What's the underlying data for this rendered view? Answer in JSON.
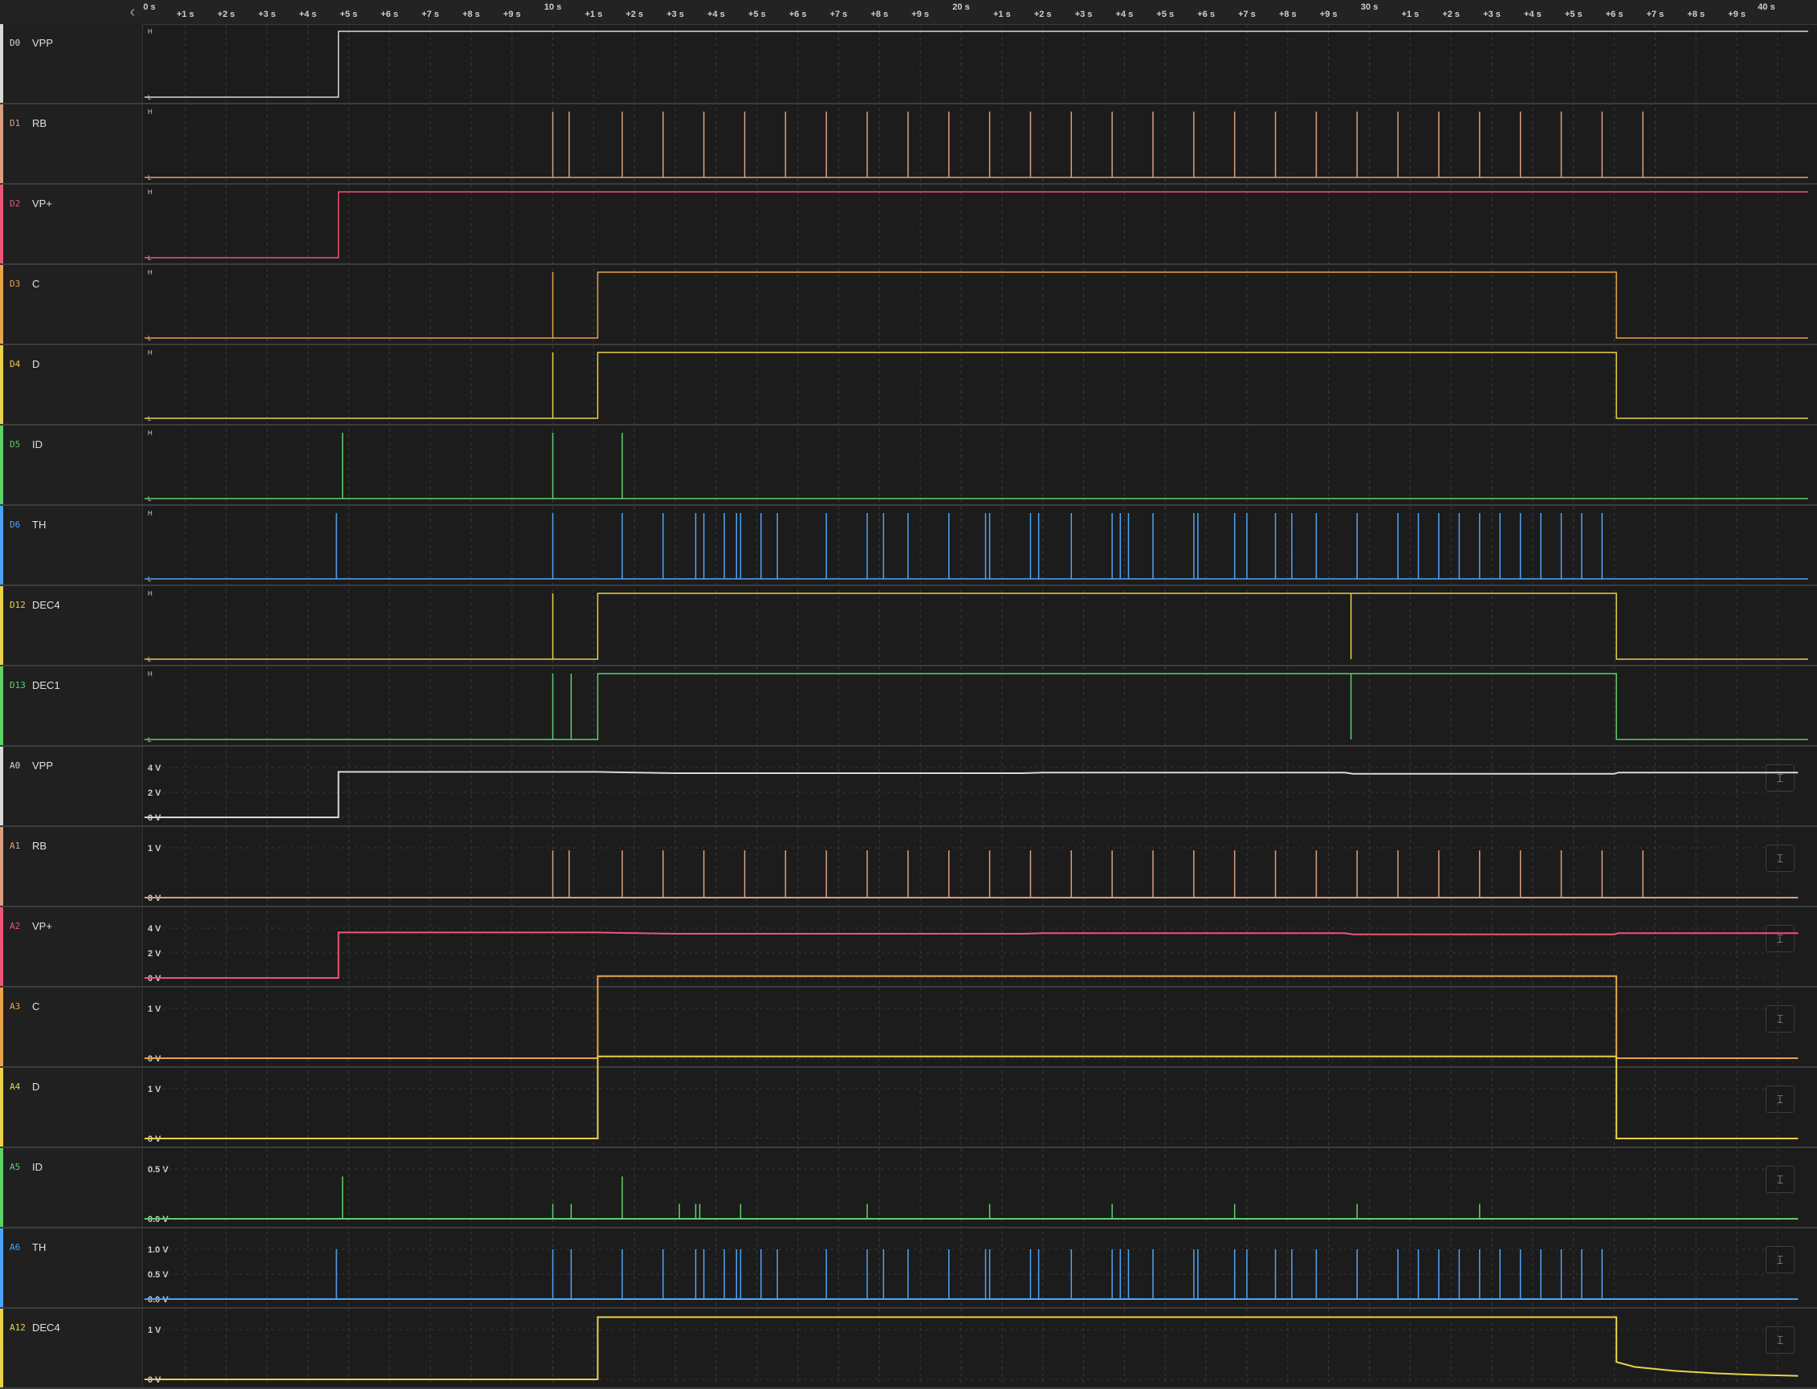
{
  "ruler": {
    "major": [
      "0 s",
      "10 s",
      "20 s",
      "30 s",
      "40 s"
    ],
    "minor": [
      "+1 s",
      "+2 s",
      "+3 s",
      "+4 s",
      "+5 s",
      "+6 s",
      "+7 s",
      "+8 s",
      "+9 s"
    ]
  },
  "collapse_icon": "chevron-left-icon",
  "axis_icon": "fit-vertical-icon",
  "channels": [
    {
      "id": "D0",
      "name": "VPP",
      "color": "#d9d9d9",
      "type": "digital",
      "signal": [
        [
          0,
          0
        ],
        [
          4.75,
          1
        ]
      ]
    },
    {
      "id": "D1",
      "name": "RB",
      "color": "#d9a07f",
      "type": "digital",
      "pulses": [
        10,
        10.4,
        11.7,
        12.7,
        13.7,
        14.7,
        15.7,
        16.7,
        17.7,
        18.7,
        19.7,
        20.7,
        21.7,
        22.7,
        23.7,
        24.7,
        25.7,
        26.7,
        27.7,
        28.7,
        29.7,
        30.7,
        31.7,
        32.7,
        33.7,
        34.7,
        35.7,
        36.7
      ]
    },
    {
      "id": "D2",
      "name": "VP+",
      "color": "#ef5577",
      "type": "digital",
      "signal": [
        [
          0,
          0
        ],
        [
          4.75,
          1
        ]
      ]
    },
    {
      "id": "D3",
      "name": "C",
      "color": "#e8a44a",
      "type": "digital",
      "signal": [
        [
          0,
          0
        ],
        [
          11.1,
          1
        ],
        [
          36.05,
          0
        ]
      ],
      "pulses": [
        10
      ]
    },
    {
      "id": "D4",
      "name": "D",
      "color": "#e9d24a",
      "type": "digital",
      "signal": [
        [
          0,
          0
        ],
        [
          11.1,
          1
        ],
        [
          36.05,
          0
        ]
      ],
      "pulses": [
        10
      ]
    },
    {
      "id": "D5",
      "name": "ID",
      "color": "#5ed06a",
      "type": "digital",
      "pulses": [
        4.85,
        10,
        11.7
      ]
    },
    {
      "id": "D6",
      "name": "TH",
      "color": "#4fa3f7",
      "type": "digital",
      "pulses": [
        4.7,
        10,
        11.7,
        12.7,
        13.5,
        13.7,
        14.2,
        14.5,
        14.6,
        15.1,
        15.5,
        16.7,
        17.7,
        18.1,
        18.7,
        19.7,
        20.6,
        20.7,
        21.7,
        21.9,
        22.7,
        23.7,
        23.9,
        24.1,
        24.7,
        25.7,
        25.8,
        26.7,
        27.0,
        27.7,
        28.1,
        28.7,
        29.7,
        30.7,
        31.2,
        31.7,
        32.2,
        32.7,
        33.2,
        33.7,
        34.2,
        34.7,
        35.2,
        35.7
      ]
    },
    {
      "id": "D12",
      "name": "DEC4",
      "color": "#e9d24a",
      "type": "digital",
      "signal": [
        [
          0,
          0
        ],
        [
          11.1,
          1
        ],
        [
          36.05,
          0
        ]
      ],
      "pulses": [
        10
      ],
      "dips": [
        29.55
      ]
    },
    {
      "id": "D13",
      "name": "DEC1",
      "color": "#5ed06a",
      "type": "digital",
      "signal": [
        [
          0,
          0
        ],
        [
          11.1,
          1
        ],
        [
          36.05,
          0
        ]
      ],
      "pulses": [
        10,
        10.45
      ],
      "dips": [
        29.55
      ]
    },
    {
      "id": "A0",
      "name": "VPP",
      "color": "#d9d9d9",
      "type": "analog",
      "scale": [
        "4 V",
        "2 V",
        "0 V"
      ],
      "min": 0,
      "max": 4,
      "trace": [
        [
          0,
          0
        ],
        [
          4.75,
          0
        ],
        [
          4.75,
          3.65
        ],
        [
          11.1,
          3.65
        ],
        [
          13,
          3.55
        ],
        [
          21.5,
          3.55
        ],
        [
          22,
          3.6
        ],
        [
          29.4,
          3.6
        ],
        [
          29.6,
          3.5
        ],
        [
          36.0,
          3.5
        ],
        [
          36.1,
          3.6
        ],
        [
          40.5,
          3.6
        ]
      ]
    },
    {
      "id": "A1",
      "name": "RB",
      "color": "#d9a07f",
      "type": "analog",
      "scale": [
        "1 V",
        "0 V"
      ],
      "min": 0,
      "max": 1,
      "trace": [
        [
          0,
          0
        ],
        [
          40.5,
          0
        ]
      ],
      "pulses": [
        10,
        10.4,
        11.7,
        12.7,
        13.7,
        14.7,
        15.7,
        16.7,
        17.7,
        18.7,
        19.7,
        20.7,
        21.7,
        22.7,
        23.7,
        24.7,
        25.7,
        26.7,
        27.7,
        28.7,
        29.7,
        30.7,
        31.7,
        32.7,
        33.7,
        34.7,
        35.7,
        36.7
      ],
      "pulse_height": 0.95
    },
    {
      "id": "A2",
      "name": "VP+",
      "color": "#ef5577",
      "type": "analog",
      "scale": [
        "4 V",
        "2 V",
        "0 V"
      ],
      "min": 0,
      "max": 4,
      "trace": [
        [
          0,
          0
        ],
        [
          4.75,
          0
        ],
        [
          4.75,
          3.65
        ],
        [
          11.1,
          3.65
        ],
        [
          13,
          3.55
        ],
        [
          21.5,
          3.55
        ],
        [
          22,
          3.6
        ],
        [
          29.4,
          3.6
        ],
        [
          29.6,
          3.5
        ],
        [
          36.0,
          3.5
        ],
        [
          36.1,
          3.6
        ],
        [
          40.5,
          3.6
        ]
      ]
    },
    {
      "id": "A3",
      "name": "C",
      "color": "#e8a44a",
      "type": "analog",
      "scale": [
        "1 V",
        "0 V"
      ],
      "min": 0,
      "max": 1,
      "trace": [
        [
          0,
          0
        ],
        [
          11.1,
          0
        ],
        [
          11.1,
          1.65
        ],
        [
          36.05,
          1.65
        ],
        [
          36.05,
          0
        ],
        [
          40.5,
          0
        ]
      ]
    },
    {
      "id": "A4",
      "name": "D",
      "color": "#e9d24a",
      "type": "analog",
      "scale": [
        "1 V",
        "0 V"
      ],
      "min": 0,
      "max": 1,
      "trace": [
        [
          0,
          0
        ],
        [
          11.1,
          0
        ],
        [
          11.1,
          1.65
        ],
        [
          36.05,
          1.65
        ],
        [
          36.05,
          0
        ],
        [
          40.5,
          0
        ]
      ]
    },
    {
      "id": "A5",
      "name": "ID",
      "color": "#5ed06a",
      "type": "analog",
      "scale": [
        "0.5 V",
        "0.0 V"
      ],
      "min": 0,
      "max": 0.5,
      "trace": [
        [
          0,
          0
        ],
        [
          40.5,
          0
        ]
      ],
      "pulses": [
        4.85,
        10,
        10.45,
        11.7,
        13.1,
        13.5,
        13.6,
        14.6,
        17.7,
        20.7,
        23.7,
        26.7,
        29.7,
        32.7
      ],
      "pulse_heights": [
        0.85,
        0.3,
        0.3,
        0.85,
        0.3,
        0.3,
        0.3,
        0.3,
        0.3,
        0.3,
        0.3,
        0.3,
        0.3,
        0.3
      ]
    },
    {
      "id": "A6",
      "name": "TH",
      "color": "#4fa3f7",
      "type": "analog",
      "scale": [
        "1.0 V",
        "0.5 V",
        "0.0 V"
      ],
      "min": 0,
      "max": 1,
      "trace": [
        [
          0,
          0
        ],
        [
          40.5,
          0
        ]
      ],
      "pulses": [
        4.7,
        10,
        10.45,
        11.7,
        12.7,
        13.5,
        13.7,
        14.2,
        14.5,
        14.6,
        15.1,
        15.5,
        16.7,
        17.7,
        18.1,
        18.7,
        19.7,
        20.6,
        20.7,
        21.7,
        21.9,
        22.7,
        23.7,
        23.9,
        24.1,
        24.7,
        25.7,
        25.8,
        26.7,
        27.0,
        27.7,
        28.1,
        28.7,
        29.7,
        30.7,
        31.2,
        31.7,
        32.2,
        32.7,
        33.2,
        33.7,
        34.2,
        34.7,
        35.2,
        35.7
      ],
      "pulse_height": 1.0
    },
    {
      "id": "A12",
      "name": "DEC4",
      "color": "#e9d24a",
      "type": "analog",
      "scale": [
        "1 V",
        "0 V"
      ],
      "min": 0,
      "max": 1,
      "trace": [
        [
          0,
          0
        ],
        [
          11.1,
          0
        ],
        [
          11.1,
          1.25
        ],
        [
          36.05,
          1.25
        ],
        [
          36.05,
          0.35
        ],
        [
          36.5,
          0.25
        ],
        [
          37.5,
          0.17
        ],
        [
          38.5,
          0.12
        ],
        [
          39.5,
          0.09
        ],
        [
          40.5,
          0.07
        ]
      ]
    }
  ]
}
